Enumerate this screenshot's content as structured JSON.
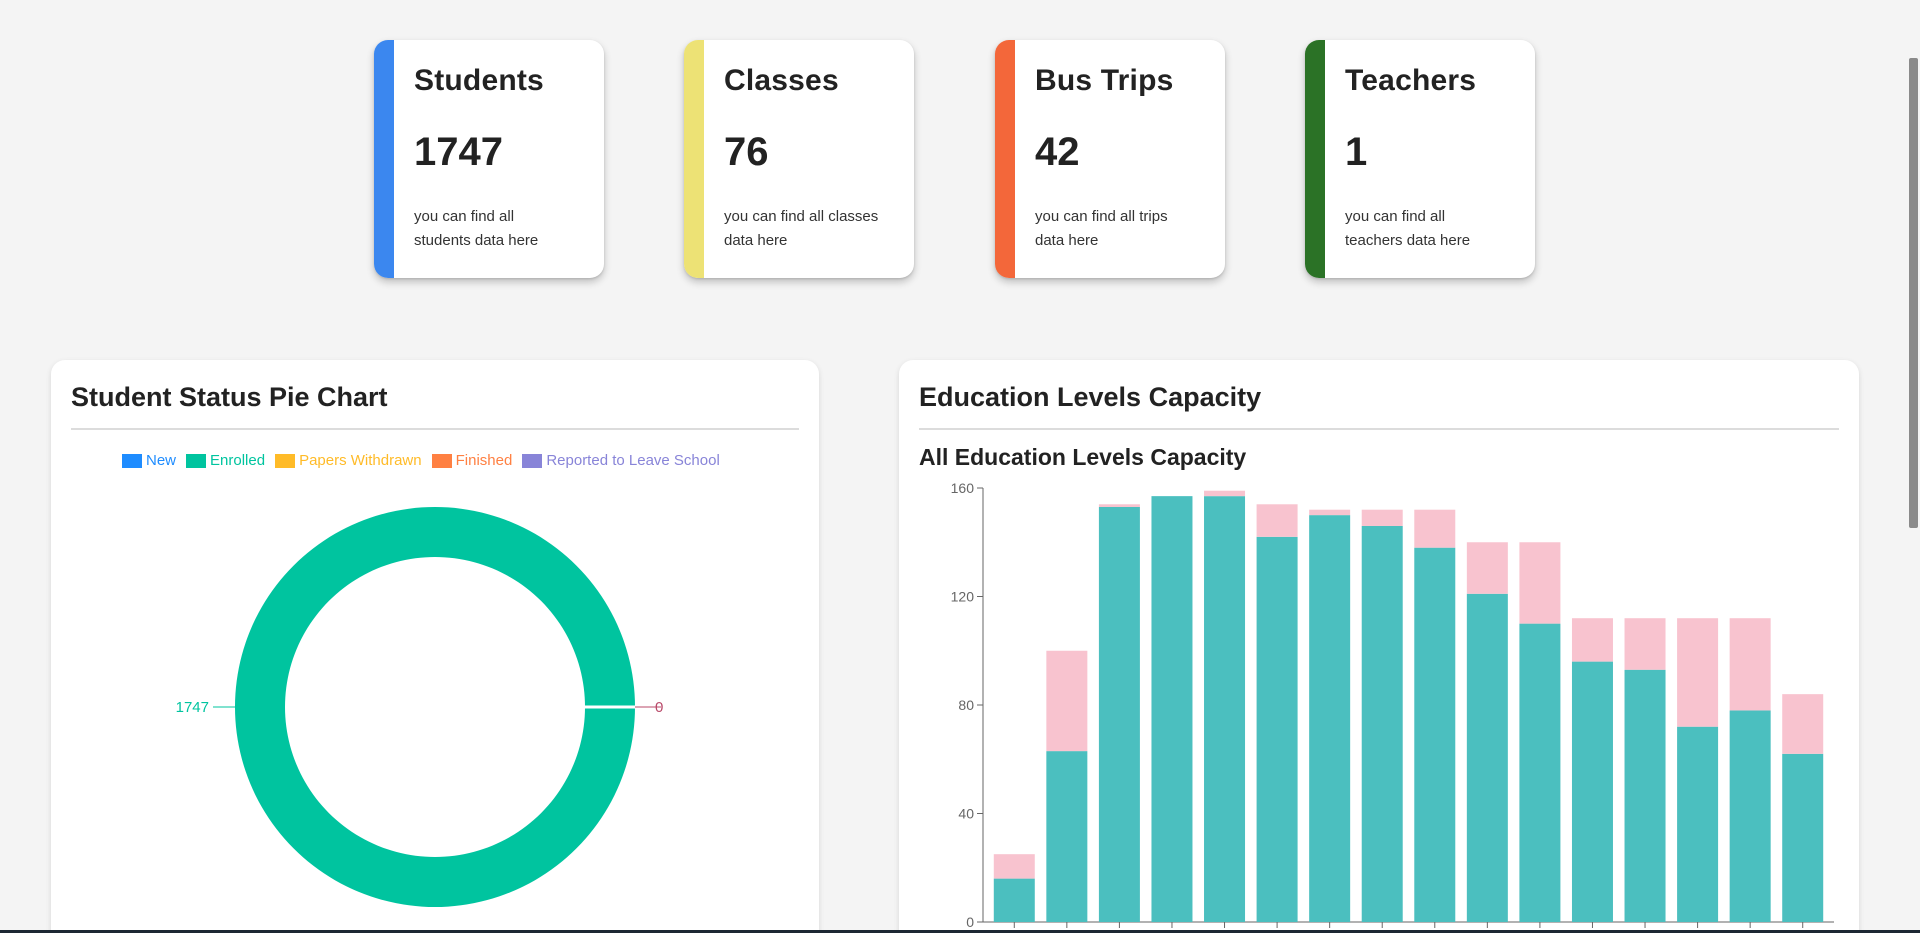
{
  "cards": [
    {
      "title": "Students",
      "value": "1747",
      "desc": "you can find all students data here",
      "color": "#3b87ef"
    },
    {
      "title": "Classes",
      "value": "76",
      "desc": "you can find all classes data here",
      "color": "#ede275"
    },
    {
      "title": "Bus Trips",
      "value": "42",
      "desc": "you can find all trips data here",
      "color": "#f3673a"
    },
    {
      "title": "Teachers",
      "value": "1",
      "desc": "you can find all teachers data here",
      "color": "#2b7226"
    }
  ],
  "pie_panel": {
    "title": "Student Status Pie Chart",
    "legend": [
      {
        "label": "New",
        "color": "#1e8cff"
      },
      {
        "label": "Enrolled",
        "color": "#00c49f"
      },
      {
        "label": "Papers Withdrawn",
        "color": "#ffbb28"
      },
      {
        "label": "Finished",
        "color": "#ff8042"
      },
      {
        "label": "Reported to Leave School",
        "color": "#8884d8"
      }
    ],
    "label_left": "1747",
    "label_right": "0"
  },
  "bar_panel": {
    "title": "Education Levels Capacity",
    "subtitle": "All Education Levels Capacity"
  },
  "chart_data": [
    {
      "type": "pie",
      "labels": [
        "New",
        "Enrolled",
        "Papers Withdrawn",
        "Finished",
        "Reported to Leave School"
      ],
      "values": [
        0,
        1747,
        0,
        0,
        0
      ],
      "colors": [
        "#1e8cff",
        "#00c49f",
        "#ffbb28",
        "#ff8042",
        "#8884d8"
      ],
      "donut": true,
      "legend": "top"
    },
    {
      "type": "bar",
      "stacked": true,
      "categories": [
        "",
        "",
        "",
        "",
        "",
        "",
        "",
        "",
        "",
        "",
        "",
        "",
        "",
        "",
        "",
        ""
      ],
      "series": [
        {
          "values": [
            16,
            63,
            153,
            157,
            157,
            142,
            150,
            146,
            138,
            121,
            110,
            96,
            93,
            72,
            78,
            62
          ],
          "color": "#4bbfbf"
        },
        {
          "values": [
            9,
            37,
            1,
            0,
            2,
            12,
            2,
            6,
            14,
            19,
            30,
            16,
            19,
            40,
            34,
            22
          ],
          "color": "#f8c3cf"
        }
      ],
      "yticks": [
        0,
        40,
        80,
        120,
        160
      ],
      "ylim": [
        0,
        160
      ],
      "grid": false
    }
  ]
}
